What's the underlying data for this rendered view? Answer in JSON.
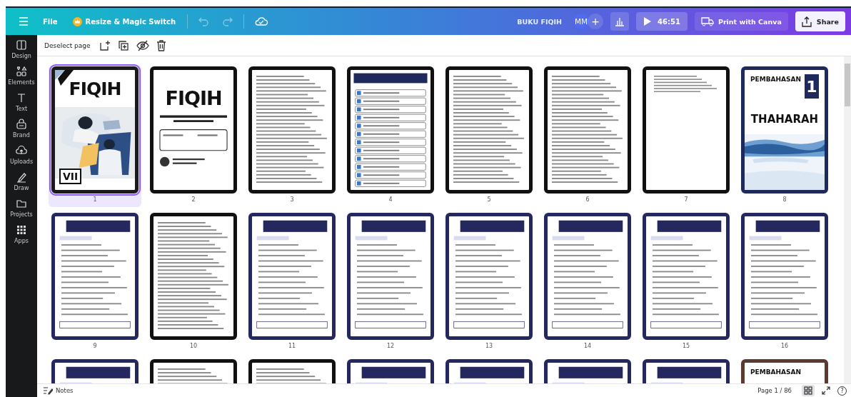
{
  "topbar": {
    "file": "File",
    "resize": "Resize & Magic Switch",
    "undo_disabled": true,
    "redo_disabled": true,
    "title": "BUKU FIQIH",
    "avatar": "MM",
    "add": "+",
    "timer": "46:51",
    "print": "Print with Canva",
    "share": "Share"
  },
  "sidebar": {
    "items": [
      {
        "label": "Design"
      },
      {
        "label": "Elements"
      },
      {
        "label": "Text"
      },
      {
        "label": "Brand"
      },
      {
        "label": "Uploads"
      },
      {
        "label": "Draw"
      },
      {
        "label": "Projects"
      },
      {
        "label": "Apps"
      }
    ]
  },
  "toolbar": {
    "deselect": "Deselect page"
  },
  "pages": [
    {
      "number": "1",
      "selected": true,
      "kind": "cover",
      "titles": [
        "FIQIH",
        "VII"
      ]
    },
    {
      "number": "2",
      "selected": false,
      "kind": "title",
      "titles": [
        "FIQIH"
      ]
    },
    {
      "number": "3",
      "selected": false,
      "kind": "text"
    },
    {
      "number": "4",
      "selected": false,
      "kind": "list"
    },
    {
      "number": "5",
      "selected": false,
      "kind": "text"
    },
    {
      "number": "6",
      "selected": false,
      "kind": "text"
    },
    {
      "number": "7",
      "selected": false,
      "kind": "short"
    },
    {
      "number": "8",
      "selected": false,
      "kind": "chapter",
      "color": "#1f2a5c",
      "titles": [
        "PEMBAHASAN",
        "1",
        "THAHARAH"
      ]
    },
    {
      "number": "9",
      "selected": false,
      "kind": "lesson"
    },
    {
      "number": "10",
      "selected": false,
      "kind": "text"
    },
    {
      "number": "11",
      "selected": false,
      "kind": "lesson"
    },
    {
      "number": "12",
      "selected": false,
      "kind": "lesson"
    },
    {
      "number": "13",
      "selected": false,
      "kind": "lesson"
    },
    {
      "number": "14",
      "selected": false,
      "kind": "lesson"
    },
    {
      "number": "15",
      "selected": false,
      "kind": "lesson"
    },
    {
      "number": "16",
      "selected": false,
      "kind": "lesson"
    },
    {
      "selected": false,
      "kind": "lesson"
    },
    {
      "selected": false,
      "kind": "text"
    },
    {
      "selected": false,
      "kind": "text"
    },
    {
      "selected": false,
      "kind": "lesson"
    },
    {
      "selected": false,
      "kind": "lesson"
    },
    {
      "selected": false,
      "kind": "lesson"
    },
    {
      "selected": false,
      "kind": "lesson"
    },
    {
      "selected": false,
      "kind": "chapter",
      "color": "#5b3a30",
      "titles": [
        "PEMBAHASAN"
      ]
    }
  ],
  "bottombar": {
    "notes": "Notes",
    "page": "Page 1 / 86",
    "grid_selected": true,
    "help": "?"
  }
}
